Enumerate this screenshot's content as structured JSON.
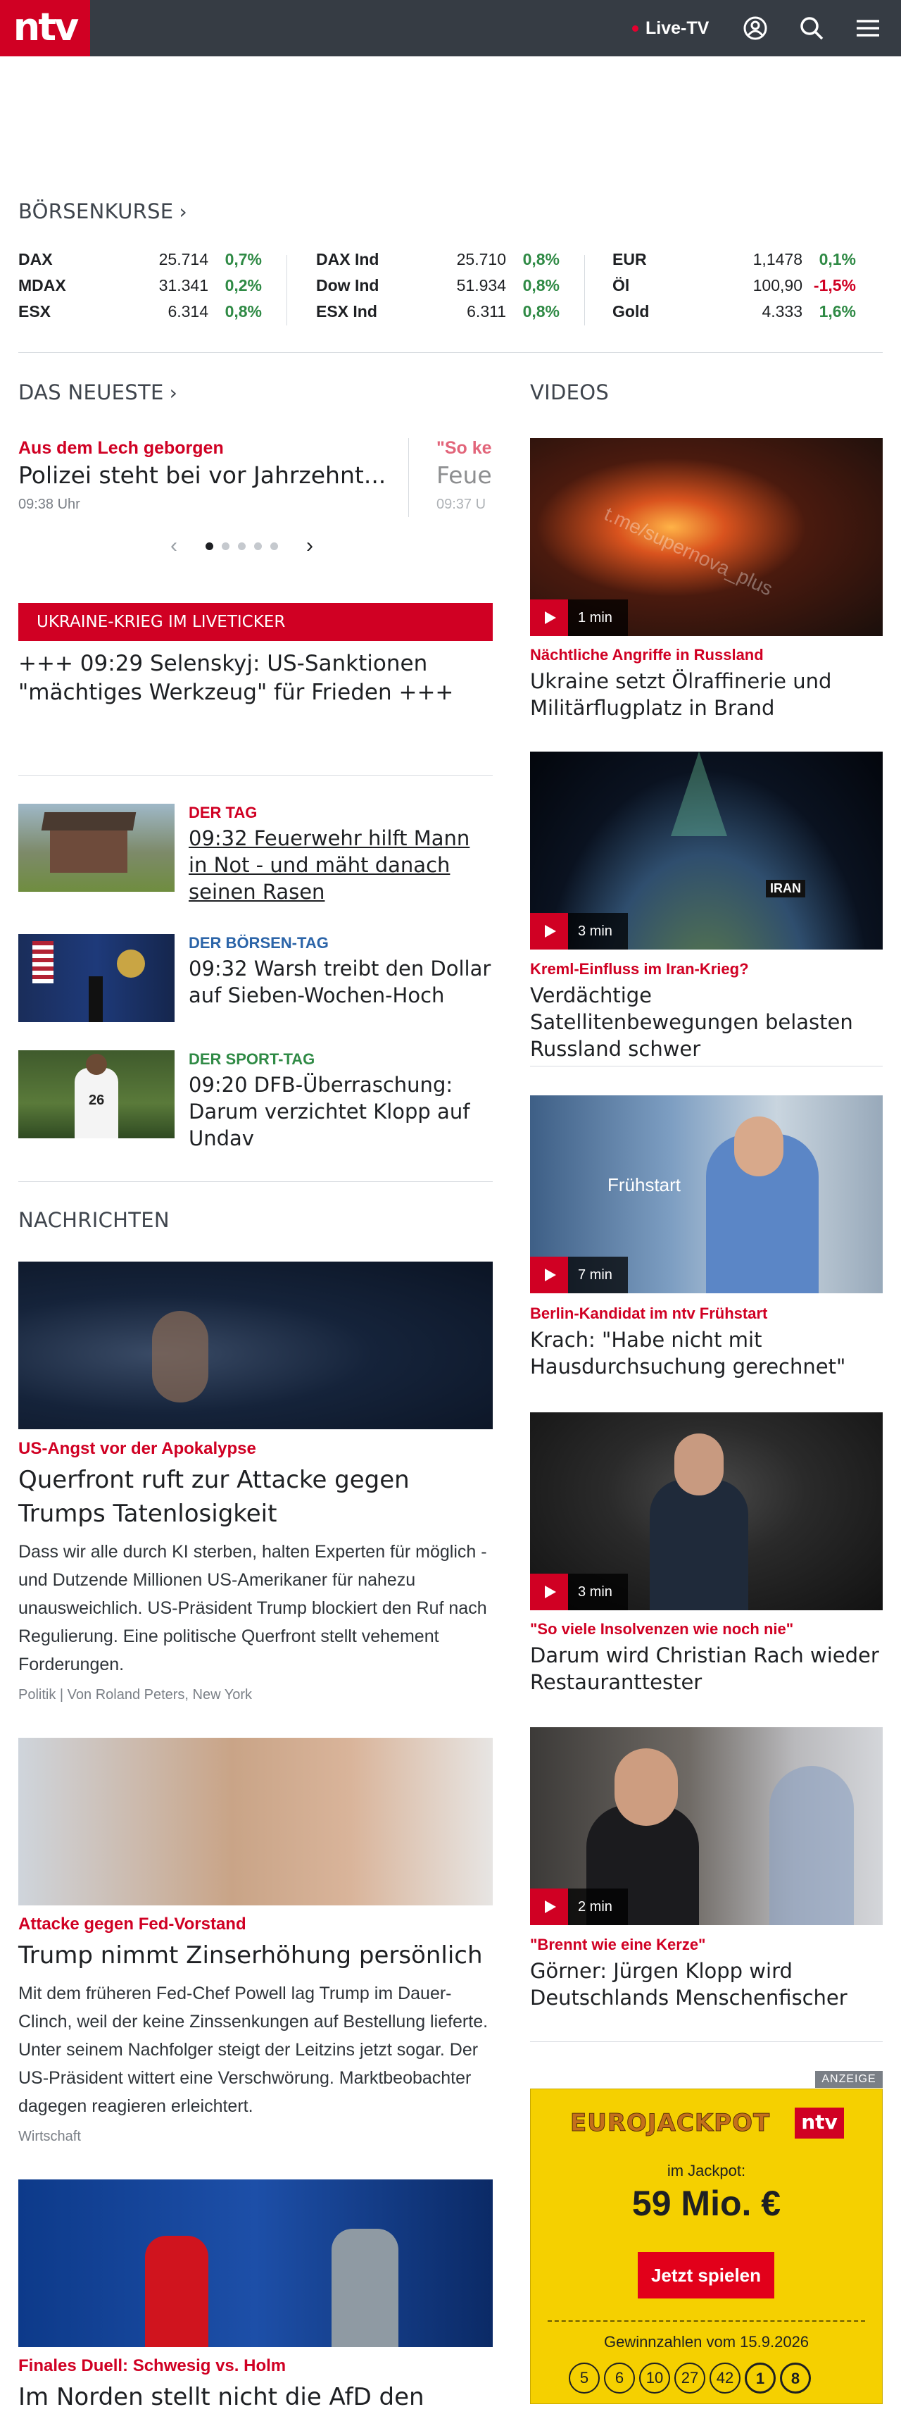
{
  "header": {
    "logo": "ntv",
    "live_label": "Live-TV",
    "icons": [
      "user-icon",
      "search-icon",
      "menu-icon"
    ]
  },
  "boerse": {
    "title": "BÖRSENKURSE",
    "columns": [
      [
        {
          "name": "DAX",
          "value": "25.714",
          "change": "0,7%",
          "dir": "pos"
        },
        {
          "name": "MDAX",
          "value": "31.341",
          "change": "0,2%",
          "dir": "pos"
        },
        {
          "name": "ESX",
          "value": "6.314",
          "change": "0,8%",
          "dir": "pos"
        }
      ],
      [
        {
          "name": "DAX Ind",
          "value": "25.710",
          "change": "0,8%",
          "dir": "pos"
        },
        {
          "name": "Dow Ind",
          "value": "51.934",
          "change": "0,8%",
          "dir": "pos"
        },
        {
          "name": "ESX Ind",
          "value": "6.311",
          "change": "0,8%",
          "dir": "pos"
        }
      ],
      [
        {
          "name": "EUR",
          "value": "1,1478",
          "change": "0,1%",
          "dir": "pos"
        },
        {
          "name": "Öl",
          "value": "100,90",
          "change": "-1,5%",
          "dir": "neg"
        },
        {
          "name": "Gold",
          "value": "4.333",
          "change": "1,6%",
          "dir": "pos"
        }
      ]
    ]
  },
  "neueste": {
    "title": "DAS NEUESTE",
    "items": [
      {
        "kicker": "Aus dem Lech geborgen",
        "headline": "Polizei steht bei vor Jahrzehnt...",
        "time": "09:38 Uhr"
      },
      {
        "kicker": "\"So ke",
        "headline": "Feue",
        "time": "09:37 U"
      }
    ]
  },
  "liveticker": {
    "label": "UKRAINE-KRIEG IM LIVETICKER",
    "headline": "+++ 09:29 Selenskyj: US-Sanktionen \"mächtiges Werkzeug\" für Frieden +++"
  },
  "tagesblocks": [
    {
      "kicker": "DER TAG",
      "kicker_color": "#d00023",
      "headline": "09:32 Feuerwehr hilft Mann in Not - und mäht danach seinen Rasen"
    },
    {
      "kicker": "DER BÖRSEN-TAG",
      "kicker_color": "#2b64a8",
      "headline": "09:32 Warsh treibt den Dollar auf Sieben-Wochen-Hoch"
    },
    {
      "kicker": "DER SPORT-TAG",
      "kicker_color": "#2f8a45",
      "headline": "09:20 DFB-Überraschung: Darum verzichtet Klopp auf Undav"
    }
  ],
  "nachrichten": {
    "title": "NACHRICHTEN",
    "articles": [
      {
        "kicker": "US-Angst vor der Apokalypse",
        "headline": "Querfront ruft zur Attacke gegen Trumps Tatenlosigkeit",
        "teaser": "Dass wir alle durch KI sterben, halten Experten für möglich - und Dutzende Millionen US-Amerikaner für nahezu unausweichlich. US-Präsident Trump blockiert den Ruf nach Regulierung. Eine politische Querfront stellt vehement Forderungen.",
        "meta": "Politik | Von Roland Peters, New York"
      },
      {
        "kicker": "Attacke gegen Fed-Vorstand",
        "headline": "Trump nimmt Zinserhöhung persönlich",
        "teaser": "Mit dem früheren Fed-Chef Powell lag Trump im Dauer-Clinch, weil der keine Zinssenkungen auf Bestellung lieferte. Unter seinem Nachfolger steigt der Leitzins jetzt sogar. Der US-Präsident wittert eine Verschwörung. Marktbeobachter dagegen reagieren erleichtert.",
        "meta": "Wirtschaft"
      },
      {
        "kicker": "Finales Duell: Schwesig vs. Holm",
        "headline": "Im Norden stellt nicht die AfD den"
      }
    ]
  },
  "videos": {
    "title": "VIDEOS",
    "items": [
      {
        "duration": "1 min",
        "kicker": "Nächtliche Angriffe in Russland",
        "headline": "Ukraine setzt Ölraffinerie und Militärflugplatz in Brand",
        "overlay": "t.me/supernova_plus"
      },
      {
        "duration": "3 min",
        "kicker": "Kreml-Einfluss im Iran-Krieg?",
        "headline": "Verdächtige Satellitenbewegungen belasten Russland schwer",
        "overlay": "IRAN"
      },
      {
        "duration": "7 min",
        "kicker": "Berlin-Kandidat im ntv Frühstart",
        "headline": "Krach: \"Habe nicht mit Hausdurchsuchung gerechnet\"",
        "overlay": "Frühstart"
      },
      {
        "duration": "3 min",
        "kicker": "\"So viele Insolvenzen wie noch nie\"",
        "headline": "Darum wird Christian Rach wieder Restauranttester"
      },
      {
        "duration": "2 min",
        "kicker": "\"Brennt wie eine Kerze\"",
        "headline": "Görner: Jürgen Klopp wird Deutschlands Menschenfischer"
      }
    ]
  },
  "ad": {
    "label": "ANZEIGE",
    "brand": "EUROJACKPOT",
    "logo": "ntv",
    "jackpot_label": "im Jackpot:",
    "jackpot": "59 Mio. €",
    "cta": "Jetzt spielen",
    "numbers_label": "Gewinnzahlen vom 15.9.2026",
    "numbers": [
      "5",
      "6",
      "10",
      "27",
      "42"
    ],
    "euro": [
      "1",
      "8"
    ]
  },
  "colors": {
    "brand": "#d00023",
    "header": "#363c44",
    "positive": "#2f8a45",
    "negative": "#d00023"
  }
}
